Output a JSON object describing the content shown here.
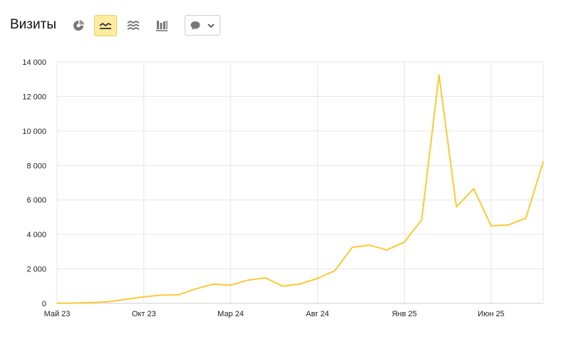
{
  "header": {
    "title": "Визиты",
    "icons": [
      "pie-chart-icon",
      "line-chart-icon",
      "area-chart-icon",
      "bar-chart-icon",
      "comment-icon",
      "chevron-down-icon"
    ],
    "active_view": "line-chart-icon"
  },
  "colors": {
    "line": "#fcc934",
    "grid": "#e6e6e6",
    "active_button": "#ffeba0",
    "icon": "#777777"
  },
  "chart_data": {
    "type": "line",
    "x_ticks": [
      "Май 23",
      "Окт 23",
      "Мар 24",
      "Авг 24",
      "Янв 25",
      "Июн 25"
    ],
    "y_ticks": [
      "0",
      "2 000",
      "4 000",
      "6 000",
      "8 000",
      "10 000",
      "12 000",
      "14 000"
    ],
    "ylim": [
      0,
      14000
    ],
    "grid": true,
    "x": [
      "2023-05",
      "2023-06",
      "2023-07",
      "2023-08",
      "2023-09",
      "2023-10",
      "2023-11",
      "2023-12",
      "2024-01",
      "2024-02",
      "2024-03",
      "2024-04",
      "2024-05",
      "2024-06",
      "2024-07",
      "2024-08",
      "2024-09",
      "2024-10",
      "2024-11",
      "2024-12",
      "2025-01",
      "2025-02",
      "2025-03",
      "2025-04",
      "2025-05",
      "2025-06",
      "2025-07",
      "2025-08",
      "2025-09"
    ],
    "series": [
      {
        "values": [
          10,
          20,
          50,
          100,
          250,
          380,
          480,
          500,
          850,
          1120,
          1060,
          1350,
          1480,
          1000,
          1130,
          1450,
          1900,
          3250,
          3380,
          3100,
          3550,
          4850,
          13250,
          5600,
          6650,
          4500,
          4550,
          4950,
          8200
        ]
      }
    ]
  }
}
